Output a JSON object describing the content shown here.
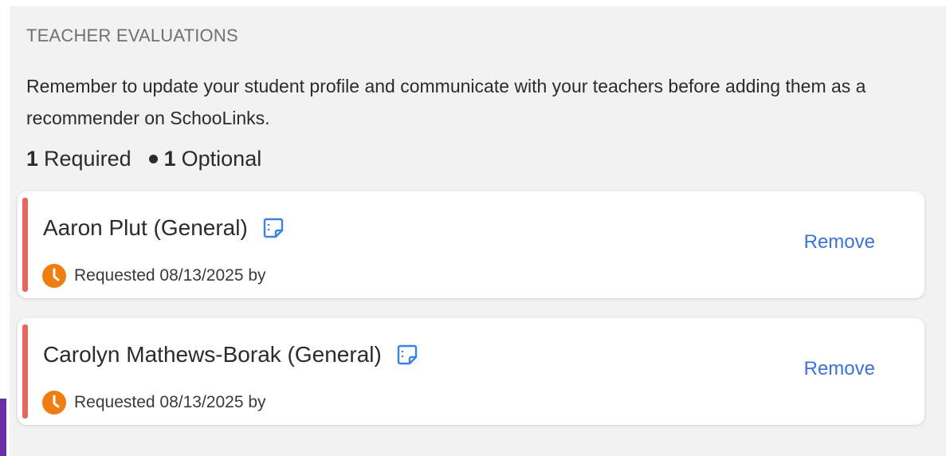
{
  "section": {
    "title": "TEACHER EVALUATIONS",
    "description": "Remember to update your student profile and communicate with your teachers before adding them as a recommender on SchooLinks.",
    "summary": {
      "required_count": "1",
      "required_label": "Required",
      "optional_count": "1",
      "optional_label": "Optional"
    }
  },
  "recommenders": [
    {
      "name": "Aaron Plut (General)",
      "status": "Requested 08/13/2025 by",
      "remove_label": "Remove",
      "note_icon": "note-icon",
      "status_icon": "clock-icon"
    },
    {
      "name": "Carolyn Mathews-Borak (General)",
      "status": "Requested 08/13/2025 by",
      "remove_label": "Remove",
      "note_icon": "note-icon",
      "status_icon": "clock-icon"
    }
  ],
  "colors": {
    "accent": "#e5675e",
    "link": "#3b73d9",
    "status_icon": "#f07d12",
    "note_icon": "#3b82e6"
  }
}
